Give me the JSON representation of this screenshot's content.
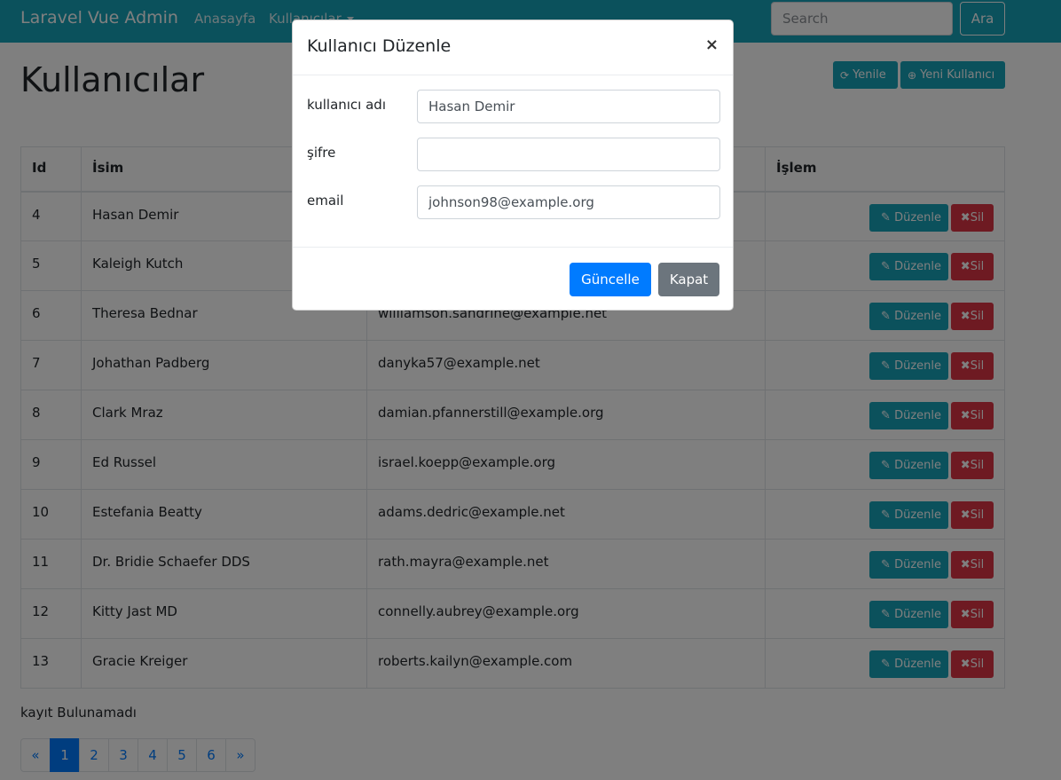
{
  "navbar": {
    "brand": "Laravel Vue Admin",
    "home": "Anasayfa",
    "users": "Kullanıcılar",
    "search_placeholder": "Search",
    "search_button": "Ara"
  },
  "page": {
    "title": "Kullanıcılar",
    "refresh_label": "Yenile",
    "new_user_label": "Yeni Kullanıcı",
    "no_record": "kayıt Bulunamadı"
  },
  "table": {
    "headers": [
      "Id",
      "İsim",
      "",
      "İşlem"
    ],
    "edit_label": "Düzenle",
    "delete_label": "Sil",
    "rows": [
      {
        "id": "4",
        "name": "Hasan Demir",
        "email": ""
      },
      {
        "id": "5",
        "name": "Kaleigh Kutch",
        "email": ""
      },
      {
        "id": "6",
        "name": "Theresa Bednar",
        "email": "williamson.sandrine@example.net"
      },
      {
        "id": "7",
        "name": "Johathan Padberg",
        "email": "danyka57@example.net"
      },
      {
        "id": "8",
        "name": "Clark Mraz",
        "email": "damian.pfannerstill@example.org"
      },
      {
        "id": "9",
        "name": "Ed Russel",
        "email": "israel.koepp@example.org"
      },
      {
        "id": "10",
        "name": "Estefania Beatty",
        "email": "adams.dedric@example.net"
      },
      {
        "id": "11",
        "name": "Dr. Bridie Schaefer DDS",
        "email": "rath.mayra@example.net"
      },
      {
        "id": "12",
        "name": "Kitty Jast MD",
        "email": "connelly.aubrey@example.org"
      },
      {
        "id": "13",
        "name": "Gracie Kreiger",
        "email": "roberts.kailyn@example.com"
      }
    ]
  },
  "pagination": {
    "prev": "«",
    "pages": [
      "1",
      "2",
      "3",
      "4",
      "5",
      "6"
    ],
    "next": "»",
    "active": "1"
  },
  "modal": {
    "title": "Kullanıcı Düzenle",
    "close_symbol": "×",
    "username_label": "kullanıcı adı",
    "username_value": "Hasan Demir",
    "password_label": "şifre",
    "password_value": "",
    "email_label": "email",
    "email_value": "johnson98@example.org",
    "update_button": "Güncelle",
    "close_button": "Kapat"
  },
  "colors": {
    "info": "#17a2b8",
    "danger": "#dc3545",
    "primary": "#007bff",
    "secondary": "#6c757d"
  }
}
